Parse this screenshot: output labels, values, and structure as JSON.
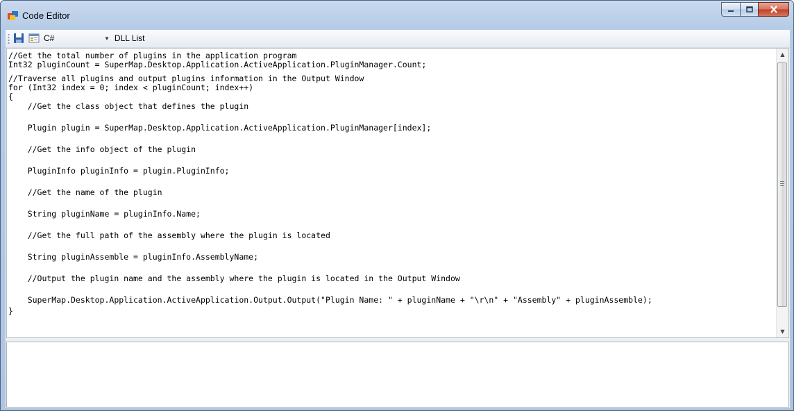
{
  "window": {
    "title": "Code Editor",
    "controls": [
      "minimize",
      "maximize",
      "close"
    ]
  },
  "toolbar": {
    "save_icon": "save-icon",
    "properties_icon": "properties-icon",
    "language": "C#",
    "dll_list_label": "DLL List"
  },
  "code": {
    "lines": [
      "//Get the total number of plugins in the application program",
      "Int32 pluginCount = SuperMap.Desktop.Application.ActiveApplication.PluginManager.Count;",
      "//Traverse all plugins and output plugins information in the Output Window",
      "for (Int32 index = 0; index < pluginCount; index++)",
      "{",
      "    //Get the class object that defines the plugin",
      "    Plugin plugin = SuperMap.Desktop.Application.ActiveApplication.PluginManager[index];",
      "    //Get the info object of the plugin",
      "    PluginInfo pluginInfo = plugin.PluginInfo;",
      "    //Get the name of the plugin",
      "    String pluginName = pluginInfo.Name;",
      "    //Get the full path of the assembly where the plugin is located",
      "    String pluginAssemble = pluginInfo.AssemblyName;",
      "    //Output the plugin name and the assembly where the plugin is located in the Output Window",
      "    SuperMap.Desktop.Application.ActiveApplication.Output.Output(\"Plugin Name: \" + pluginName + \"\\r\\n\" + \"Assembly\" + pluginAssemble);",
      "}"
    ]
  },
  "output": {
    "text": ""
  },
  "colors": {
    "frame": "#b6cbe6",
    "close_button": "#c0412b"
  }
}
